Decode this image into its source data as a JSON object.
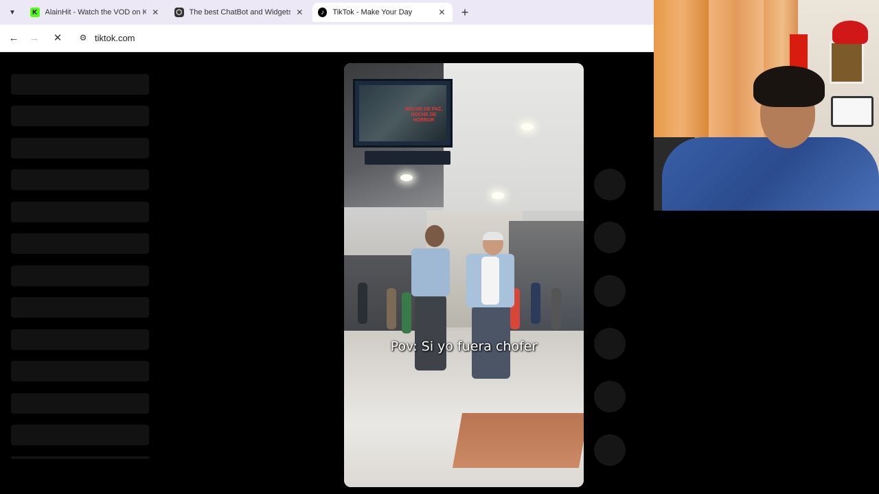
{
  "browser": {
    "tabs": [
      {
        "favicon": "kick-icon",
        "title": "AlainHit - Watch the VOD on K",
        "active": false
      },
      {
        "favicon": "chatbot-icon",
        "title": "The best ChatBot and Widgets",
        "active": false
      },
      {
        "favicon": "tiktok-icon",
        "title": "TikTok - Make Your Day",
        "active": true
      }
    ],
    "url": "tiktok.com"
  },
  "video": {
    "caption": "Pov: Si yo fuera chofer",
    "tv_text": "NOCHE DE PAZ, NOCHE DE HORROR"
  },
  "colors": {
    "tabbar_bg": "#ece8f5",
    "page_bg": "#000000",
    "skeleton": "#121212",
    "side_button": "#161616"
  }
}
